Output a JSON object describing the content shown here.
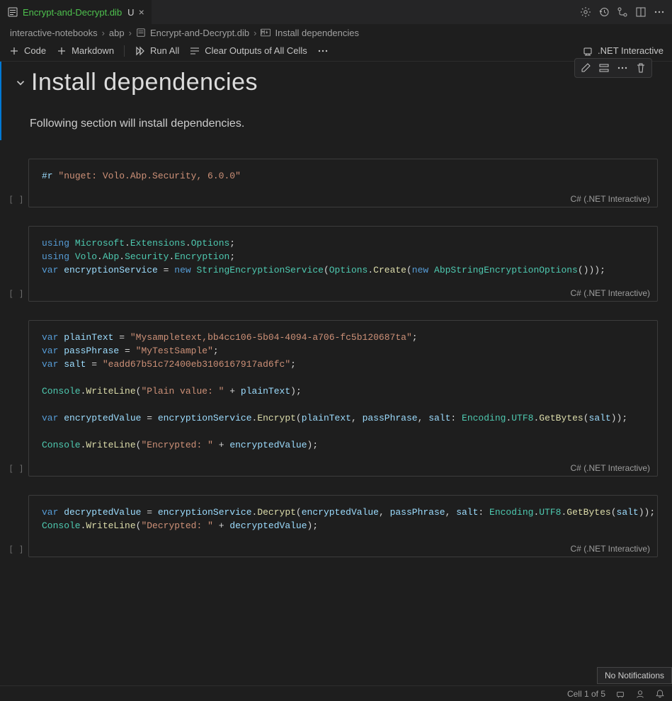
{
  "tab": {
    "filename": "Encrypt-and-Decrypt.dib",
    "modified_indicator": "U"
  },
  "tabbar_icons": [
    "gear",
    "history",
    "diff",
    "split",
    "more"
  ],
  "breadcrumb": {
    "parts": [
      "interactive-notebooks",
      "abp",
      "Encrypt-and-Decrypt.dib",
      "Install dependencies"
    ]
  },
  "toolbar": {
    "add_code": "Code",
    "add_markdown": "Markdown",
    "run_all": "Run All",
    "clear_outputs": "Clear Outputs of All Cells",
    "kernel": ".NET Interactive"
  },
  "cell_actions": [
    "edit",
    "split-cell",
    "more",
    "delete"
  ],
  "markdown_cell": {
    "title": "Install dependencies",
    "body": "Following section will install dependencies."
  },
  "cells": [
    {
      "exec": "[ ]",
      "language": "C# (.NET Interactive)",
      "code": {
        "nuget_ref": "#r \"nuget: Volo.Abp.Security, 6.0.0\""
      }
    },
    {
      "exec": "[ ]",
      "language": "C# (.NET Interactive)",
      "code": {
        "using1": "using Microsoft.Extensions.Options;",
        "using2": "using Volo.Abp.Security.Encryption;",
        "var_decl": "var encryptionService = new StringEncryptionService(Options.Create(new AbpStringEncryptionOptions()));"
      }
    },
    {
      "exec": "[ ]",
      "language": "C# (.NET Interactive)",
      "code": {
        "plainText": "\"Mysampletext,bb4cc106-5b04-4094-a706-fc5b120687ta\"",
        "passPhrase": "\"MyTestSample\"",
        "salt": "\"eadd67b51c72400eb3106167917ad6fc\"",
        "writeline_plain_label": "\"Plain value: \"",
        "encrypt_call": "encryptionService.Encrypt(plainText, passPhrase, salt: Encoding.UTF8.GetBytes(salt));",
        "writeline_enc_label": "\"Encrypted: \""
      }
    },
    {
      "exec": "[ ]",
      "language": "C# (.NET Interactive)",
      "code": {
        "decrypt_call": "encryptionService.Decrypt(encryptedValue, passPhrase, salt: Encoding.UTF8.GetBytes(salt));",
        "writeline_dec_label": "\"Decrypted: \""
      }
    }
  ],
  "statusbar": {
    "cell_pos": "Cell 1 of 5"
  },
  "toast": {
    "no_notifications": "No Notifications"
  }
}
